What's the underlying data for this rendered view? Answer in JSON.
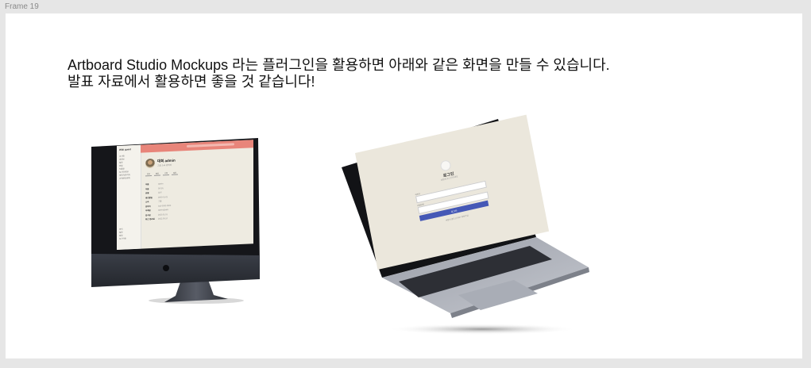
{
  "frame": {
    "label": "Frame 19"
  },
  "caption": {
    "line1": "Artboard Studio Mockups 라는 플러그인을 활용하면 아래와 같은 화면을 만들 수 있습니다.",
    "line2": "발표 자료에서 활용하면 좋을 것 같습니다!"
  },
  "imac_screen": {
    "brand": "Wiki guest",
    "nav_items": [
      "초기화",
      "내정보",
      "설정",
      "파일",
      "도움말",
      "로그인/회원",
      "제작자/관리자",
      "고객센터/문의"
    ],
    "nav_bottom": [
      "마이",
      "설정",
      "알림",
      "로그아웃"
    ],
    "profile_name": "대회 admin",
    "profile_sub": "그룹 소속 관리자",
    "tabs": [
      "정보",
      "활동",
      "기록",
      "설정"
    ],
    "rows": [
      {
        "k": "이름",
        "v": "admin"
      },
      {
        "k": "이름",
        "v": "관리자"
      },
      {
        "k": "성별",
        "v": "남성"
      },
      {
        "k": "생년월일",
        "v": "2000-01-01"
      },
      {
        "k": "소속",
        "v": "그룹"
      },
      {
        "k": "연락처",
        "v": "010-0000-0000"
      },
      {
        "k": "이메일",
        "v": "admin@wiki"
      },
      {
        "k": "입사일",
        "v": "2020.01.01"
      },
      {
        "k": "최근 접속일",
        "v": "2022.05.10"
      }
    ]
  },
  "laptop_screen": {
    "title": "로그인",
    "subtitle": "계정에 로그인하세요",
    "id_label": "아이디",
    "password_label": "비밀번호",
    "login_button": "로그인",
    "signup_link": "계정이 없으신가요? 회원가입"
  },
  "colors": {
    "frame_background": "#ffffff",
    "canvas_background": "#e6e6e6",
    "imac_topbar": "#e8857a",
    "screen_background": "#eeebe1",
    "login_button": "#4558b6"
  }
}
